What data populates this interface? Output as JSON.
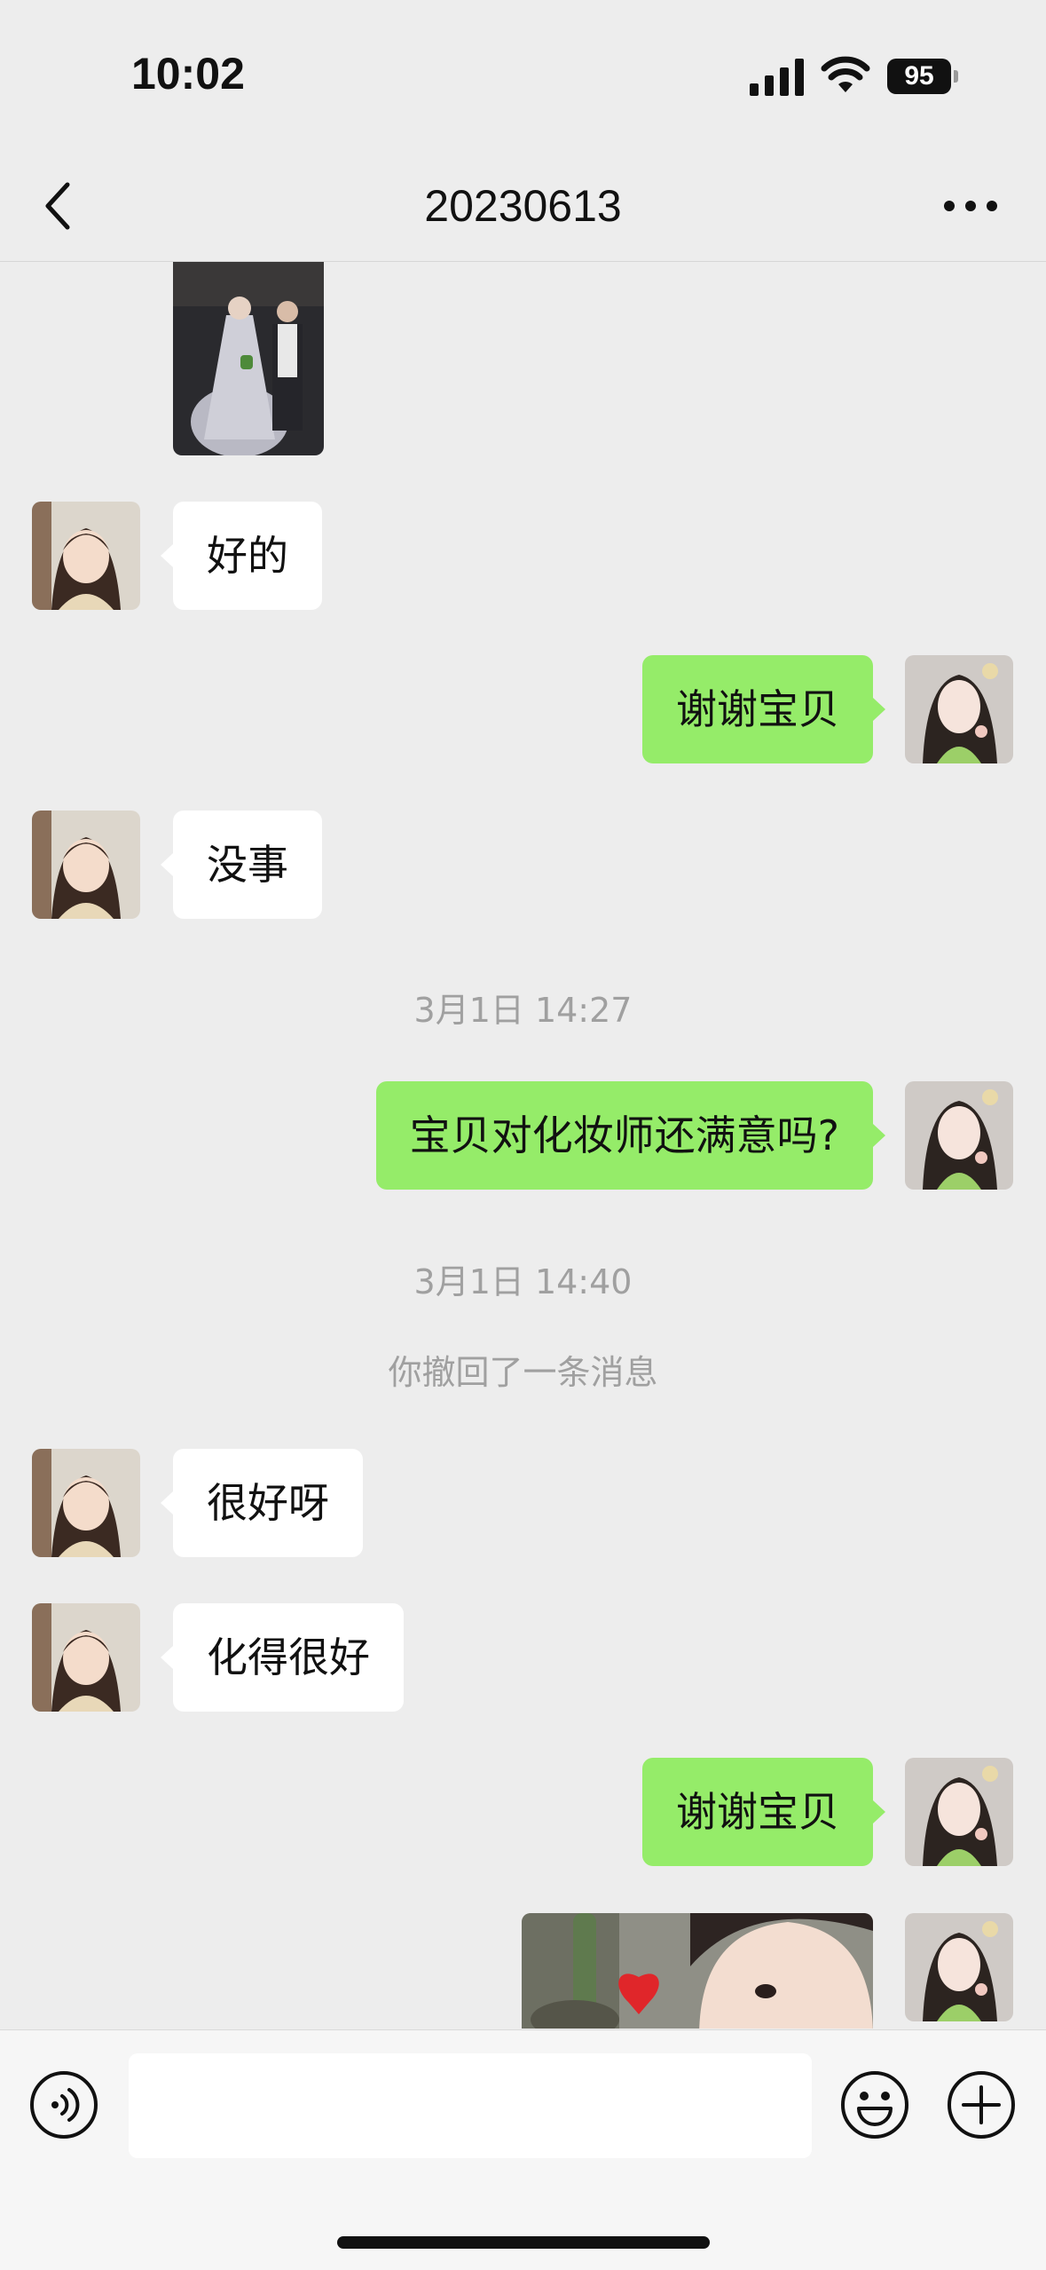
{
  "status_bar": {
    "time": "10:02",
    "battery": "95"
  },
  "nav": {
    "title": "20230613"
  },
  "messages": [
    {
      "side": "in",
      "text": "好的"
    },
    {
      "side": "out",
      "text": "谢谢宝贝"
    },
    {
      "side": "in",
      "text": "没事"
    },
    {
      "timestamp": "3月1日 14:27"
    },
    {
      "side": "out",
      "text": "宝贝对化妆师还满意吗?"
    },
    {
      "timestamp": "3月1日 14:40"
    },
    {
      "system": "你撤回了一条消息"
    },
    {
      "side": "in",
      "text": "很好呀"
    },
    {
      "side": "in",
      "text": "化得很好"
    },
    {
      "side": "out",
      "text": "谢谢宝贝"
    }
  ],
  "input": {
    "value": ""
  },
  "colors": {
    "outgoing_bubble": "#95ec69",
    "incoming_bubble": "#ffffff",
    "background": "#ededed"
  }
}
